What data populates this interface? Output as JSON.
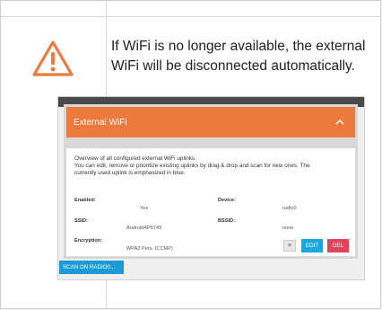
{
  "note": {
    "line1": "If WiFi is no longer available, the external",
    "line2": "WiFi will be disconnected automatically."
  },
  "panel": {
    "title": "External WiFi",
    "description": [
      "Overview of all configured external WiFi uplinks.",
      "You can edit, remove or prioritize existing uplinks by drag & drop and scan for new ones. The",
      "currently used uplink is emphasized in blue."
    ],
    "fields": {
      "enabled_label": "Enabled:",
      "enabled_value": "Yes",
      "device_label": "Device:",
      "device_value": "radio0",
      "ssid_label": "SSID:",
      "ssid_value": "AndroidAP6749",
      "bssid_label": "BSSID:",
      "bssid_value": "none",
      "encryption_label": "Encryption:",
      "encryption_value": "WPA2 Pers. (CCMP)"
    },
    "edit_label": "EDIT",
    "del_label": "DEL",
    "scan_label": "SCAN ON RADIO0..."
  },
  "colors": {
    "warning": "#ec7a3c",
    "header": "#ec7a3c",
    "edit": "#1aa7e0",
    "delete": "#e0435a",
    "scan": "#1c9ad6"
  },
  "icons": {
    "warning": "warning-icon",
    "collapse": "chevron-up-icon",
    "drag": "drag-handle-icon"
  }
}
